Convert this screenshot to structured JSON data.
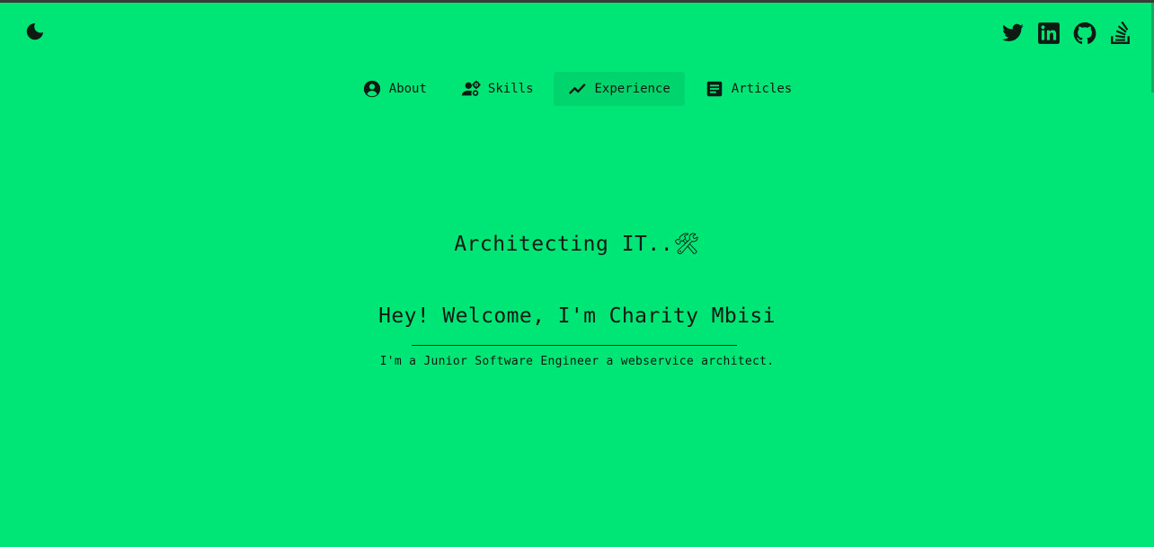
{
  "header": {
    "theme_icon": "moon-icon",
    "social_icons": [
      "twitter-icon",
      "linkedin-icon",
      "github-icon",
      "stackoverflow-icon"
    ]
  },
  "nav": {
    "items": [
      {
        "label": "About",
        "icon": "user-circle-icon"
      },
      {
        "label": "Skills",
        "icon": "user-gear-icon"
      },
      {
        "label": "Experience",
        "icon": "trending-line-icon"
      },
      {
        "label": "Articles",
        "icon": "article-icon"
      }
    ],
    "active": "Experience"
  },
  "hero": {
    "title": "Architecting IT..🛠",
    "welcome": "Hey! Welcome, I'm Charity Mbisi",
    "tagline": "I'm a Junior Software Engineer a webservice architect."
  },
  "colors": {
    "background": "#00e676",
    "active_tab": "#00d46c",
    "text": "#0f1a14"
  }
}
